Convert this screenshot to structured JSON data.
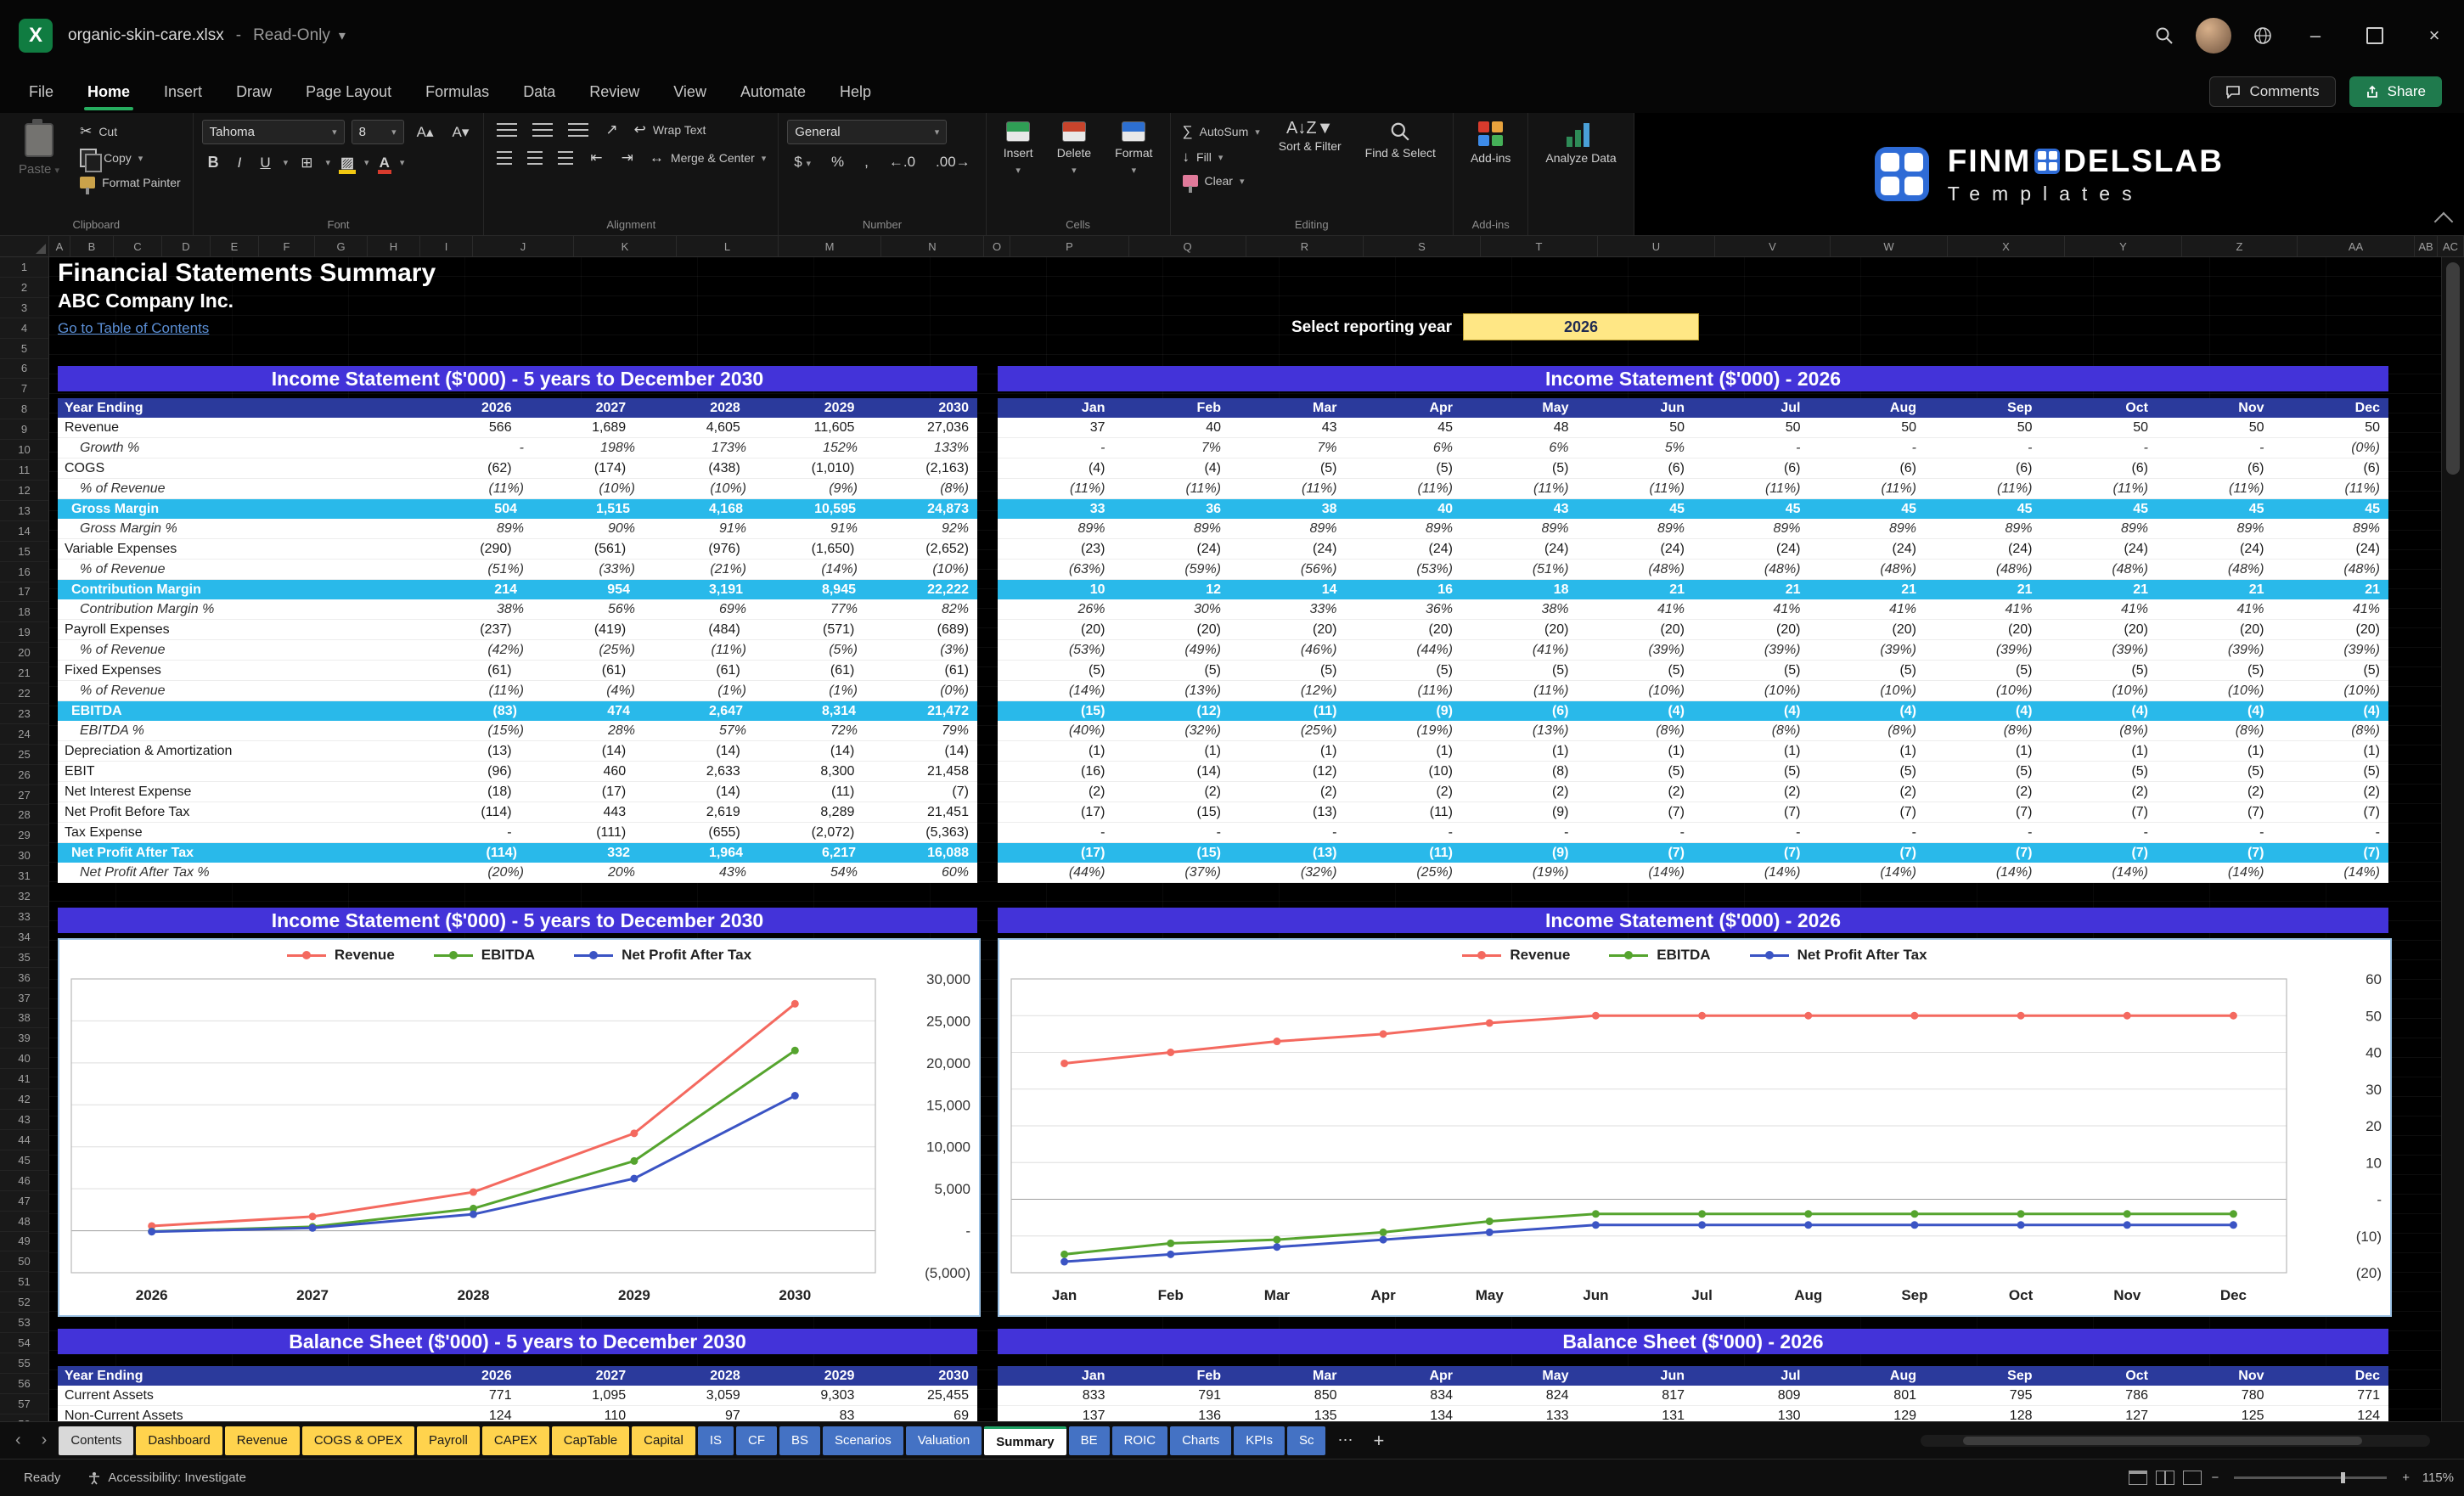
{
  "titlebar": {
    "filename": "organic-skin-care.xlsx",
    "separator": "-",
    "mode": "Read-Only"
  },
  "menubar": {
    "tabs": [
      "File",
      "Home",
      "Insert",
      "Draw",
      "Page Layout",
      "Formulas",
      "Data",
      "Review",
      "View",
      "Automate",
      "Help"
    ],
    "active": "Home",
    "comments": "Comments",
    "share": "Share"
  },
  "ribbon": {
    "clipboard": {
      "group": "Clipboard",
      "paste": "Paste",
      "cut": "Cut",
      "copy": "Copy",
      "format_painter": "Format Painter"
    },
    "font": {
      "group": "Font",
      "family": "Tahoma",
      "size": "8",
      "bold": "B",
      "italic": "I",
      "underline": "U"
    },
    "alignment": {
      "group": "Alignment",
      "wrap_text": "Wrap Text",
      "merge_center": "Merge & Center"
    },
    "number": {
      "group": "Number",
      "format": "General",
      "currency": "$",
      "percent": "%",
      "comma": ","
    },
    "cells": {
      "group": "Cells",
      "insert": "Insert",
      "delete": "Delete",
      "format": "Format"
    },
    "editing": {
      "group": "Editing",
      "autosum": "AutoSum",
      "fill": "Fill",
      "clear": "Clear",
      "sort_filter": "Sort & Filter",
      "find_select": "Find & Select"
    },
    "addins": {
      "group": "Add-ins",
      "label": "Add-ins"
    },
    "analyze": {
      "label": "Analyze Data"
    }
  },
  "brand": {
    "prefix": "FINM",
    "suffix": "DELSLAB",
    "tagline": "Templates"
  },
  "sheet": {
    "title": "Financial Statements Summary",
    "company": "ABC Company Inc.",
    "link": "Go to Table of Contents",
    "select_year_label": "Select reporting year",
    "selected_year": "2026",
    "row_count": 60,
    "columns": [
      "A",
      "B",
      "C",
      "D",
      "E",
      "F",
      "G",
      "H",
      "I",
      "J",
      "K",
      "L",
      "M",
      "N",
      "O",
      "P",
      "Q",
      "R",
      "S",
      "T",
      "U",
      "V",
      "W",
      "X",
      "Y",
      "Z",
      "AA",
      "AB",
      "AC"
    ],
    "years": [
      "2026",
      "2027",
      "2028",
      "2029",
      "2030"
    ],
    "months": [
      "Jan",
      "Feb",
      "Mar",
      "Apr",
      "May",
      "Jun",
      "Jul",
      "Aug",
      "Sep",
      "Oct",
      "Nov",
      "Dec"
    ],
    "income_statement": {
      "left_title": "Income Statement ($'000) - 5 years to December 2030",
      "right_title": "Income Statement ($'000) - 2026",
      "header_label": "Year Ending",
      "rows": [
        {
          "label": "Revenue",
          "style": "normal",
          "yearly": [
            "566",
            "1,689",
            "4,605",
            "11,605",
            "27,036"
          ],
          "monthly": [
            "37",
            "40",
            "43",
            "45",
            "48",
            "50",
            "50",
            "50",
            "50",
            "50",
            "50",
            "50"
          ]
        },
        {
          "label": "Growth %",
          "style": "pct",
          "yearly": [
            "-",
            "198%",
            "173%",
            "152%",
            "133%"
          ],
          "monthly": [
            "-",
            "7%",
            "7%",
            "6%",
            "6%",
            "5%",
            "-",
            "-",
            "-",
            "-",
            "-",
            "(0%)"
          ]
        },
        {
          "label": "COGS",
          "style": "normal",
          "yearly": [
            "(62)",
            "(174)",
            "(438)",
            "(1,010)",
            "(2,163)"
          ],
          "monthly": [
            "(4)",
            "(4)",
            "(5)",
            "(5)",
            "(5)",
            "(6)",
            "(6)",
            "(6)",
            "(6)",
            "(6)",
            "(6)",
            "(6)"
          ]
        },
        {
          "label": "% of Revenue",
          "style": "pct",
          "yearly": [
            "(11%)",
            "(10%)",
            "(10%)",
            "(9%)",
            "(8%)"
          ],
          "monthly": [
            "(11%)",
            "(11%)",
            "(11%)",
            "(11%)",
            "(11%)",
            "(11%)",
            "(11%)",
            "(11%)",
            "(11%)",
            "(11%)",
            "(11%)",
            "(11%)"
          ]
        },
        {
          "label": "Gross Margin",
          "style": "cyan",
          "yearly": [
            "504",
            "1,515",
            "4,168",
            "10,595",
            "24,873"
          ],
          "monthly": [
            "33",
            "36",
            "38",
            "40",
            "43",
            "45",
            "45",
            "45",
            "45",
            "45",
            "45",
            "45"
          ]
        },
        {
          "label": "Gross Margin %",
          "style": "pct",
          "yearly": [
            "89%",
            "90%",
            "91%",
            "91%",
            "92%"
          ],
          "monthly": [
            "89%",
            "89%",
            "89%",
            "89%",
            "89%",
            "89%",
            "89%",
            "89%",
            "89%",
            "89%",
            "89%",
            "89%"
          ]
        },
        {
          "label": "Variable Expenses",
          "style": "normal",
          "yearly": [
            "(290)",
            "(561)",
            "(976)",
            "(1,650)",
            "(2,652)"
          ],
          "monthly": [
            "(23)",
            "(24)",
            "(24)",
            "(24)",
            "(24)",
            "(24)",
            "(24)",
            "(24)",
            "(24)",
            "(24)",
            "(24)",
            "(24)"
          ]
        },
        {
          "label": "% of Revenue",
          "style": "pct",
          "yearly": [
            "(51%)",
            "(33%)",
            "(21%)",
            "(14%)",
            "(10%)"
          ],
          "monthly": [
            "(63%)",
            "(59%)",
            "(56%)",
            "(53%)",
            "(51%)",
            "(48%)",
            "(48%)",
            "(48%)",
            "(48%)",
            "(48%)",
            "(48%)",
            "(48%)"
          ]
        },
        {
          "label": "Contribution Margin",
          "style": "cyan",
          "yearly": [
            "214",
            "954",
            "3,191",
            "8,945",
            "22,222"
          ],
          "monthly": [
            "10",
            "12",
            "14",
            "16",
            "18",
            "21",
            "21",
            "21",
            "21",
            "21",
            "21",
            "21"
          ]
        },
        {
          "label": "Contribution Margin %",
          "style": "pct",
          "yearly": [
            "38%",
            "56%",
            "69%",
            "77%",
            "82%"
          ],
          "monthly": [
            "26%",
            "30%",
            "33%",
            "36%",
            "38%",
            "41%",
            "41%",
            "41%",
            "41%",
            "41%",
            "41%",
            "41%"
          ]
        },
        {
          "label": "Payroll Expenses",
          "style": "normal",
          "yearly": [
            "(237)",
            "(419)",
            "(484)",
            "(571)",
            "(689)"
          ],
          "monthly": [
            "(20)",
            "(20)",
            "(20)",
            "(20)",
            "(20)",
            "(20)",
            "(20)",
            "(20)",
            "(20)",
            "(20)",
            "(20)",
            "(20)"
          ]
        },
        {
          "label": "% of Revenue",
          "style": "pct",
          "yearly": [
            "(42%)",
            "(25%)",
            "(11%)",
            "(5%)",
            "(3%)"
          ],
          "monthly": [
            "(53%)",
            "(49%)",
            "(46%)",
            "(44%)",
            "(41%)",
            "(39%)",
            "(39%)",
            "(39%)",
            "(39%)",
            "(39%)",
            "(39%)",
            "(39%)"
          ]
        },
        {
          "label": "Fixed Expenses",
          "style": "normal",
          "yearly": [
            "(61)",
            "(61)",
            "(61)",
            "(61)",
            "(61)"
          ],
          "monthly": [
            "(5)",
            "(5)",
            "(5)",
            "(5)",
            "(5)",
            "(5)",
            "(5)",
            "(5)",
            "(5)",
            "(5)",
            "(5)",
            "(5)"
          ]
        },
        {
          "label": "% of Revenue",
          "style": "pct",
          "yearly": [
            "(11%)",
            "(4%)",
            "(1%)",
            "(1%)",
            "(0%)"
          ],
          "monthly": [
            "(14%)",
            "(13%)",
            "(12%)",
            "(11%)",
            "(11%)",
            "(10%)",
            "(10%)",
            "(10%)",
            "(10%)",
            "(10%)",
            "(10%)",
            "(10%)"
          ]
        },
        {
          "label": "EBITDA",
          "style": "cyan",
          "yearly": [
            "(83)",
            "474",
            "2,647",
            "8,314",
            "21,472"
          ],
          "monthly": [
            "(15)",
            "(12)",
            "(11)",
            "(9)",
            "(6)",
            "(4)",
            "(4)",
            "(4)",
            "(4)",
            "(4)",
            "(4)",
            "(4)"
          ]
        },
        {
          "label": "EBITDA %",
          "style": "pct",
          "yearly": [
            "(15%)",
            "28%",
            "57%",
            "72%",
            "79%"
          ],
          "monthly": [
            "(40%)",
            "(32%)",
            "(25%)",
            "(19%)",
            "(13%)",
            "(8%)",
            "(8%)",
            "(8%)",
            "(8%)",
            "(8%)",
            "(8%)",
            "(8%)"
          ]
        },
        {
          "label": "Depreciation & Amortization",
          "style": "normal",
          "yearly": [
            "(13)",
            "(14)",
            "(14)",
            "(14)",
            "(14)"
          ],
          "monthly": [
            "(1)",
            "(1)",
            "(1)",
            "(1)",
            "(1)",
            "(1)",
            "(1)",
            "(1)",
            "(1)",
            "(1)",
            "(1)",
            "(1)"
          ]
        },
        {
          "label": "EBIT",
          "style": "normal",
          "yearly": [
            "(96)",
            "460",
            "2,633",
            "8,300",
            "21,458"
          ],
          "monthly": [
            "(16)",
            "(14)",
            "(12)",
            "(10)",
            "(8)",
            "(5)",
            "(5)",
            "(5)",
            "(5)",
            "(5)",
            "(5)",
            "(5)"
          ]
        },
        {
          "label": "Net Interest Expense",
          "style": "normal",
          "yearly": [
            "(18)",
            "(17)",
            "(14)",
            "(11)",
            "(7)"
          ],
          "monthly": [
            "(2)",
            "(2)",
            "(2)",
            "(2)",
            "(2)",
            "(2)",
            "(2)",
            "(2)",
            "(2)",
            "(2)",
            "(2)",
            "(2)"
          ]
        },
        {
          "label": "Net Profit Before Tax",
          "style": "normal",
          "yearly": [
            "(114)",
            "443",
            "2,619",
            "8,289",
            "21,451"
          ],
          "monthly": [
            "(17)",
            "(15)",
            "(13)",
            "(11)",
            "(9)",
            "(7)",
            "(7)",
            "(7)",
            "(7)",
            "(7)",
            "(7)",
            "(7)"
          ]
        },
        {
          "label": "Tax Expense",
          "style": "normal",
          "yearly": [
            "-",
            "(111)",
            "(655)",
            "(2,072)",
            "(5,363)"
          ],
          "monthly": [
            "-",
            "-",
            "-",
            "-",
            "-",
            "-",
            "-",
            "-",
            "-",
            "-",
            "-",
            "-"
          ]
        },
        {
          "label": "Net Profit After Tax",
          "style": "cyan",
          "yearly": [
            "(114)",
            "332",
            "1,964",
            "6,217",
            "16,088"
          ],
          "monthly": [
            "(17)",
            "(15)",
            "(13)",
            "(11)",
            "(9)",
            "(7)",
            "(7)",
            "(7)",
            "(7)",
            "(7)",
            "(7)",
            "(7)"
          ]
        },
        {
          "label": "Net Profit After Tax %",
          "style": "pct",
          "yearly": [
            "(20%)",
            "20%",
            "43%",
            "54%",
            "60%"
          ],
          "monthly": [
            "(44%)",
            "(37%)",
            "(32%)",
            "(25%)",
            "(19%)",
            "(14%)",
            "(14%)",
            "(14%)",
            "(14%)",
            "(14%)",
            "(14%)",
            "(14%)"
          ]
        }
      ]
    },
    "balance_sheet": {
      "left_title": "Balance Sheet ($'000) - 5 years to December 2030",
      "right_title": "Balance Sheet ($'000) - 2026",
      "header_label": "Year Ending",
      "rows": [
        {
          "label": "Current Assets",
          "style": "normal",
          "yearly": [
            "771",
            "1,095",
            "3,059",
            "9,303",
            "25,455"
          ],
          "monthly": [
            "833",
            "791",
            "850",
            "834",
            "824",
            "817",
            "809",
            "801",
            "795",
            "786",
            "780",
            "771"
          ]
        },
        {
          "label": "Non-Current Assets",
          "style": "normal",
          "yearly": [
            "124",
            "110",
            "97",
            "83",
            "69"
          ],
          "monthly": [
            "137",
            "136",
            "135",
            "134",
            "133",
            "131",
            "130",
            "129",
            "128",
            "127",
            "125",
            "124"
          ]
        }
      ]
    }
  },
  "chart_data": [
    {
      "type": "line",
      "title": "Income Statement ($'000) - 5 years to December 2030",
      "categories": [
        "2026",
        "2027",
        "2028",
        "2029",
        "2030"
      ],
      "series": [
        {
          "name": "Revenue",
          "color": "#f4695f",
          "values": [
            566,
            1689,
            4605,
            11605,
            27036
          ]
        },
        {
          "name": "EBITDA",
          "color": "#55a42e",
          "values": [
            -83,
            474,
            2647,
            8314,
            21472
          ]
        },
        {
          "name": "Net Profit After Tax",
          "color": "#3b54c4",
          "values": [
            -114,
            332,
            1964,
            6217,
            16088
          ]
        }
      ],
      "ylim": [
        -5000,
        30000
      ],
      "ytick": 5000,
      "legend_position": "top",
      "grid": true
    },
    {
      "type": "line",
      "title": "Income Statement ($'000) - 2026",
      "categories": [
        "Jan",
        "Feb",
        "Mar",
        "Apr",
        "May",
        "Jun",
        "Jul",
        "Aug",
        "Sep",
        "Oct",
        "Nov",
        "Dec"
      ],
      "series": [
        {
          "name": "Revenue",
          "color": "#f4695f",
          "values": [
            37,
            40,
            43,
            45,
            48,
            50,
            50,
            50,
            50,
            50,
            50,
            50
          ]
        },
        {
          "name": "EBITDA",
          "color": "#55a42e",
          "values": [
            -15,
            -12,
            -11,
            -9,
            -6,
            -4,
            -4,
            -4,
            -4,
            -4,
            -4,
            -4
          ]
        },
        {
          "name": "Net Profit After Tax",
          "color": "#3b54c4",
          "values": [
            -17,
            -15,
            -13,
            -11,
            -9,
            -7,
            -7,
            -7,
            -7,
            -7,
            -7,
            -7
          ]
        }
      ],
      "ylim": [
        -20,
        60
      ],
      "ytick": 10,
      "legend_position": "top",
      "grid": true
    }
  ],
  "tabs": {
    "items": [
      {
        "label": "Contents",
        "color": "plain"
      },
      {
        "label": "Dashboard",
        "color": "yellow"
      },
      {
        "label": "Revenue",
        "color": "yellow"
      },
      {
        "label": "COGS & OPEX",
        "color": "yellow"
      },
      {
        "label": "Payroll",
        "color": "yellow"
      },
      {
        "label": "CAPEX",
        "color": "yellow"
      },
      {
        "label": "CapTable",
        "color": "yellow"
      },
      {
        "label": "Capital",
        "color": "yellow"
      },
      {
        "label": "IS",
        "color": "blue"
      },
      {
        "label": "CF",
        "color": "blue"
      },
      {
        "label": "BS",
        "color": "blue"
      },
      {
        "label": "Scenarios",
        "color": "blue"
      },
      {
        "label": "Valuation",
        "color": "blue"
      },
      {
        "label": "Summary",
        "color": "active"
      },
      {
        "label": "BE",
        "color": "blue"
      },
      {
        "label": "ROIC",
        "color": "blue"
      },
      {
        "label": "Charts",
        "color": "blue"
      },
      {
        "label": "KPIs",
        "color": "blue"
      },
      {
        "label": "Sc",
        "color": "blue"
      }
    ]
  },
  "status": {
    "ready": "Ready",
    "accessibility": "Accessibility: Investigate",
    "zoom": "115%"
  }
}
